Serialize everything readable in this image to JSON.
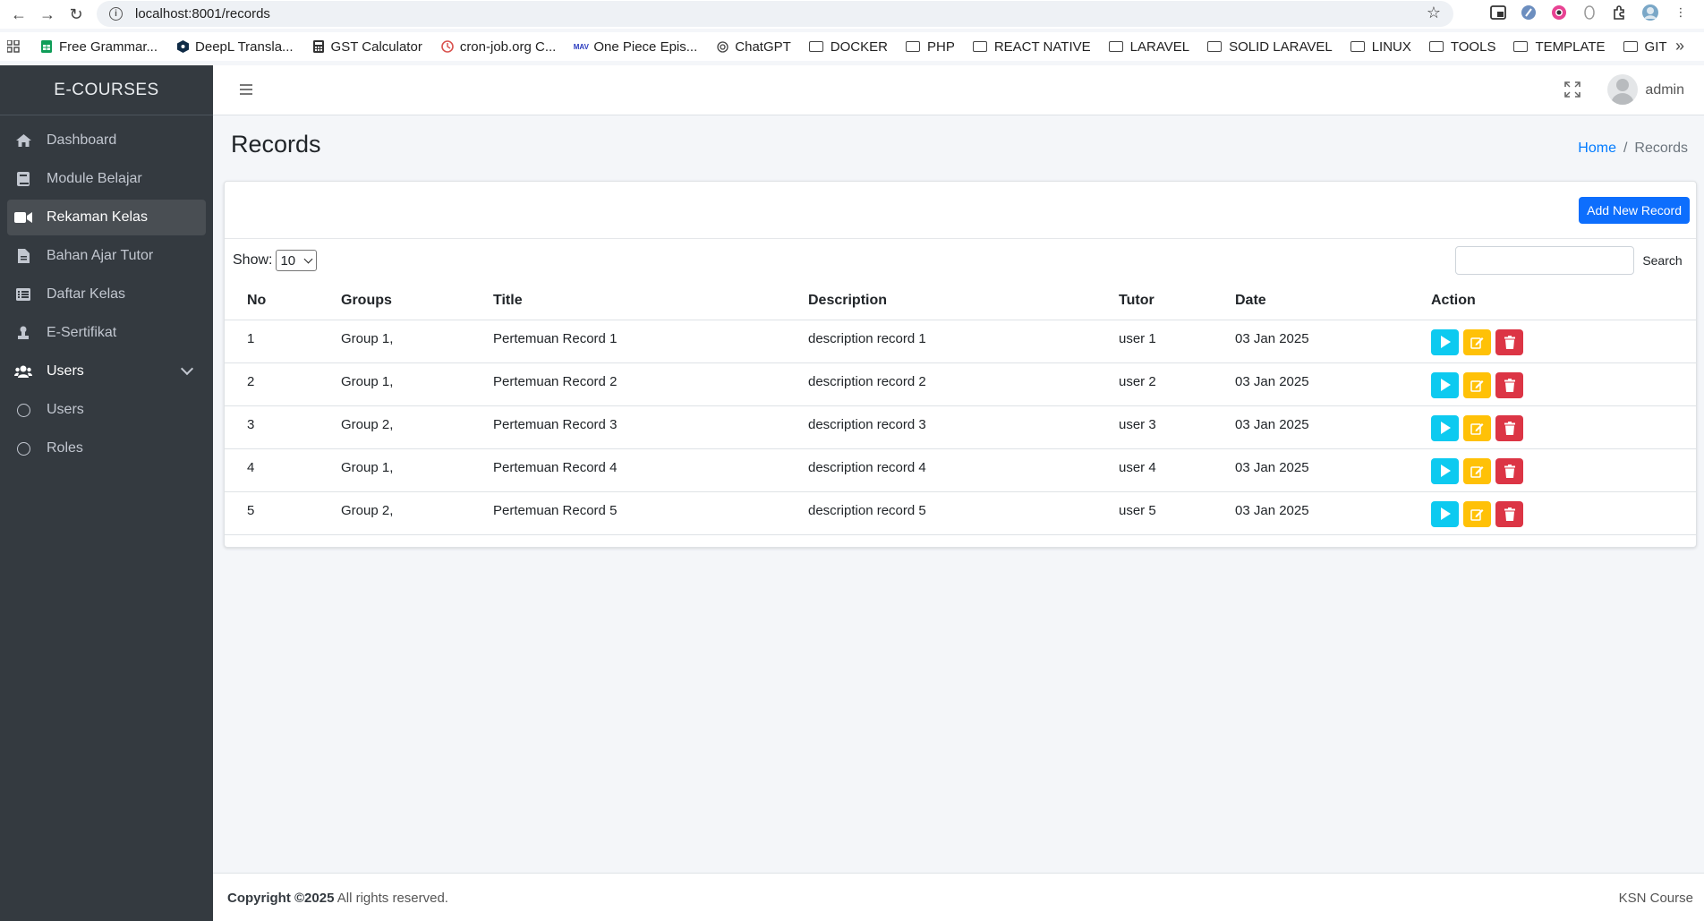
{
  "browser": {
    "url": "localhost:8001/records",
    "bookmarks": [
      {
        "label": "Free Grammar...",
        "icon": "sheets-icon"
      },
      {
        "label": "DeepL Transla...",
        "icon": "deepl-icon"
      },
      {
        "label": "GST Calculator",
        "icon": "calculator-icon"
      },
      {
        "label": "cron-job.org C...",
        "icon": "cron-icon"
      },
      {
        "label": "One Piece Epis...",
        "icon": "anime-icon"
      },
      {
        "label": "ChatGPT",
        "icon": "chatgpt-icon"
      },
      {
        "label": "DOCKER",
        "icon": "folder-icon"
      },
      {
        "label": "PHP",
        "icon": "folder-icon"
      },
      {
        "label": "REACT NATIVE",
        "icon": "folder-icon"
      },
      {
        "label": "LARAVEL",
        "icon": "folder-icon"
      },
      {
        "label": "SOLID LARAVEL",
        "icon": "folder-icon"
      },
      {
        "label": "LINUX",
        "icon": "folder-icon"
      },
      {
        "label": "TOOLS",
        "icon": "folder-icon"
      },
      {
        "label": "TEMPLATE",
        "icon": "folder-icon"
      },
      {
        "label": "GIT",
        "icon": "folder-icon"
      }
    ]
  },
  "sidebar": {
    "brand": "E-COURSES",
    "items": [
      {
        "label": "Dashboard",
        "icon": "home-icon"
      },
      {
        "label": "Module Belajar",
        "icon": "book-icon"
      },
      {
        "label": "Rekaman Kelas",
        "icon": "video-icon",
        "active": true
      },
      {
        "label": "Bahan Ajar Tutor",
        "icon": "file-icon"
      },
      {
        "label": "Daftar Kelas",
        "icon": "list-icon"
      },
      {
        "label": "E-Sertifikat",
        "icon": "certificate-icon"
      },
      {
        "label": "Users",
        "icon": "users-icon"
      },
      {
        "label": "Users",
        "icon": "circle-icon"
      },
      {
        "label": "Roles",
        "icon": "circle-icon"
      }
    ]
  },
  "navbar": {
    "username": "admin"
  },
  "page": {
    "title": "Records",
    "breadcrumb": {
      "home": "Home",
      "separator": "/",
      "current": "Records"
    }
  },
  "card": {
    "add_button": "Add New Record",
    "show_label": "Show:",
    "show_value": "10",
    "search_button": "Search"
  },
  "table": {
    "headers": [
      "No",
      "Groups",
      "Title",
      "Description",
      "Tutor",
      "Date",
      "Action"
    ],
    "rows": [
      {
        "no": "1",
        "groups": "Group 1,",
        "title": "Pertemuan Record 1",
        "description": "description record 1",
        "tutor": "user 1",
        "date": "03 Jan 2025"
      },
      {
        "no": "2",
        "groups": "Group 1,",
        "title": "Pertemuan Record 2",
        "description": "description record 2",
        "tutor": "user 2",
        "date": "03 Jan 2025"
      },
      {
        "no": "3",
        "groups": "Group 2,",
        "title": "Pertemuan Record 3",
        "description": "description record 3",
        "tutor": "user 3",
        "date": "03 Jan 2025"
      },
      {
        "no": "4",
        "groups": "Group 1,",
        "title": "Pertemuan Record 4",
        "description": "description record 4",
        "tutor": "user 4",
        "date": "03 Jan 2025"
      },
      {
        "no": "5",
        "groups": "Group 2,",
        "title": "Pertemuan Record 5",
        "description": "description record 5",
        "tutor": "user 5",
        "date": "03 Jan 2025"
      }
    ]
  },
  "footer": {
    "copyright": "Copyright ©2025",
    "rights": "All rights reserved.",
    "brand": "KSN Course"
  },
  "colors": {
    "sidebar_bg": "#343a40",
    "primary": "#0d6efd",
    "info": "#0dcaf0",
    "warning": "#ffc107",
    "danger": "#dc3545"
  }
}
